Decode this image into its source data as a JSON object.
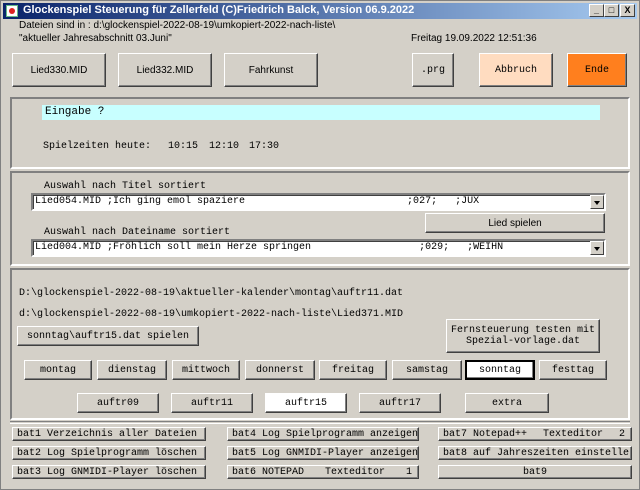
{
  "window": {
    "title": "Glockenspiel Steuerung für Zellerfeld  (C)Friedrich Balck, Version 06.9.2022",
    "controls": [
      "_",
      "□",
      "X"
    ]
  },
  "header": {
    "dir_line": "Dateien sind in :  d:\\glockenspiel-2022-08-19\\umkopiert-2022-nach-liste\\",
    "period_line": "\"aktueller Jahresabschnitt  03.Juni\"",
    "datetime": "Freitag  19.09.2022 12:51:36"
  },
  "top_buttons": {
    "lied330": "Lied330.MID",
    "lied332": "Lied332.MID",
    "fahrkunst": "Fahrkunst",
    "prg": ".prg",
    "abbruch": "Abbruch",
    "ende": "Ende"
  },
  "colors": {
    "abbruch_bg": "#ffdcc0",
    "ende_bg": "#ff7f1e",
    "eingabe_bg": "#c8ffff",
    "title_start": "#0a246a",
    "title_end": "#a6caf0"
  },
  "input_panel": {
    "eingabe": "Eingabe ?",
    "spielzeiten_label": "Spielzeiten heute:",
    "times": [
      "10:15",
      "12:10",
      "17:30"
    ]
  },
  "select_panel": {
    "title_label": "Auswahl nach Titel sortiert",
    "title_value": "Lied054.MID ;Ich ging emol spaziere                           ;027;   ;JUX",
    "lied_spielen": "Lied spielen",
    "file_label": "Auswahl nach Dateiname sortiert",
    "file_value": "Lied004.MID ;Fröhlich soll mein Herze springen                  ;029;   ;WEIHN"
  },
  "paths_panel": {
    "path1": "D:\\glockenspiel-2022-08-19\\aktueller-kalender\\montag\\auftr11.dat",
    "path2": "d:\\glockenspiel-2022-08-19\\umkopiert-2022-nach-liste\\Lied371.MID",
    "play_button": "sonntag\\auftr15.dat  spielen",
    "remote_test_line1": "Fernsteuerung testen mit",
    "remote_test_line2": "Spezial-vorlage.dat",
    "days": [
      "montag",
      "dienstag",
      "mittwoch",
      "donnerst",
      "freitag",
      "samstag",
      "sonntag",
      "festtag"
    ],
    "auftr": [
      "auftr09",
      "auftr11",
      "auftr15",
      "auftr17",
      "extra"
    ]
  },
  "bat_buttons": {
    "bat1": "bat1 Verzeichnis aller Dateien",
    "bat2": "bat2 Log Spielprogramm löschen",
    "bat3": "bat3 Log GNMIDI-Player löschen",
    "bat4": "bat4 Log Spielprogramm anzeigen",
    "bat5": "bat5 Log GNMIDI-Player anzeigen",
    "bat6": "bat6 NOTEPAD",
    "bat6_tail": "Texteditor",
    "bat6_num": "1",
    "bat7": "bat7 Notepad++",
    "bat7_tail": "Texteditor",
    "bat7_num": "2",
    "bat8": "bat8 auf Jahreszeiten einstelle",
    "bat9": "bat9"
  }
}
